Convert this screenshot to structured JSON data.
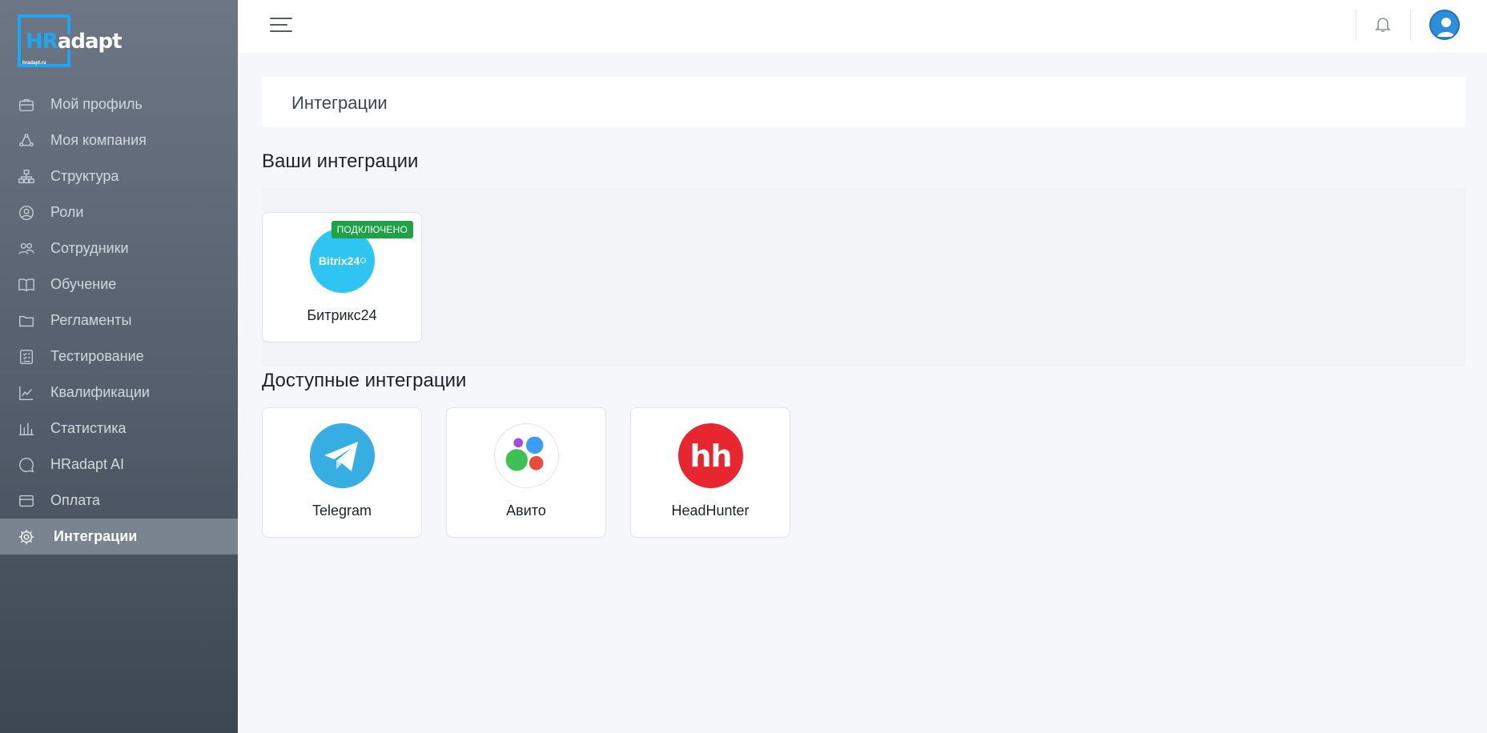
{
  "brand": {
    "logo_hr": "HR",
    "logo_adapt": "adapt",
    "logo_sub": "hradapt.ru",
    "colors": {
      "accent": "#1ea7f0",
      "sidebar": "#5a6472"
    }
  },
  "sidebar": {
    "items": [
      {
        "label": "Мой профиль",
        "icon": "briefcase-icon"
      },
      {
        "label": "Моя компания",
        "icon": "company-icon"
      },
      {
        "label": "Структура",
        "icon": "structure-icon"
      },
      {
        "label": "Роли",
        "icon": "user-circle-icon"
      },
      {
        "label": "Сотрудники",
        "icon": "users-icon"
      },
      {
        "label": "Обучение",
        "icon": "book-icon"
      },
      {
        "label": "Регламенты",
        "icon": "folder-icon"
      },
      {
        "label": "Тестирование",
        "icon": "checklist-icon"
      },
      {
        "label": "Квалификации",
        "icon": "chart-line-icon"
      },
      {
        "label": "Статистика",
        "icon": "bar-chart-icon"
      },
      {
        "label": "HRadapt AI",
        "icon": "chat-icon"
      },
      {
        "label": "Оплата",
        "icon": "credit-card-icon"
      },
      {
        "label": "Интеграции",
        "icon": "gear-icon",
        "active": true
      }
    ]
  },
  "header": {
    "page_title": "Интеграции"
  },
  "connected": {
    "title": "Ваши интеграции",
    "items": [
      {
        "label": "Битрикс24",
        "logo_text": "Bitrix24",
        "badge": "ПОДКЛЮЧЕНО",
        "color": "#2ec5f3"
      }
    ]
  },
  "available": {
    "title": "Доступные интеграции",
    "items": [
      {
        "label": "Telegram",
        "color": "#37aee2"
      },
      {
        "label": "Авито"
      },
      {
        "label": "HeadHunter",
        "logo_text": "hh",
        "color": "#e8262f"
      }
    ]
  },
  "status_colors": {
    "connected": "#1fa245"
  }
}
